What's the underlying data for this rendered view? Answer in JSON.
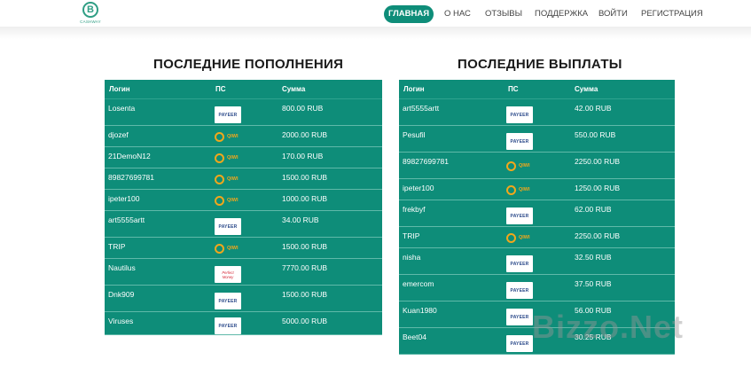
{
  "header": {
    "logo_text": "CASHWAY",
    "logo_mark": "B",
    "nav": [
      {
        "label": "ГЛАВНАЯ",
        "active": true
      },
      {
        "label": "О НАС",
        "active": false
      },
      {
        "label": "ОТЗЫВЫ",
        "active": false
      },
      {
        "label": "ПОДДЕРЖКА",
        "active": false
      },
      {
        "label": "ВОЙТИ",
        "active": false
      },
      {
        "label": "РЕГИСТРАЦИЯ",
        "active": false
      }
    ]
  },
  "deposits": {
    "title": "ПОСЛЕДНИЕ ПОПОЛНЕНИЯ",
    "columns": [
      "Логин",
      "ПС",
      "Сумма"
    ],
    "rows": [
      {
        "login": "Losenta",
        "ps": "payeer",
        "amount": "800.00 RUB"
      },
      {
        "login": "djozef",
        "ps": "qiwi",
        "amount": "2000.00 RUB"
      },
      {
        "login": "21DemoN12",
        "ps": "qiwi",
        "amount": "170.00 RUB"
      },
      {
        "login": "89827699781",
        "ps": "qiwi",
        "amount": "1500.00 RUB"
      },
      {
        "login": "ipeter100",
        "ps": "qiwi",
        "amount": "1000.00 RUB"
      },
      {
        "login": "art5555artt",
        "ps": "payeer",
        "amount": "34.00 RUB"
      },
      {
        "login": "TRIP",
        "ps": "qiwi",
        "amount": "1500.00 RUB"
      },
      {
        "login": "Nautilus",
        "ps": "perfect",
        "amount": "7770.00 RUB"
      },
      {
        "login": "Dnk909",
        "ps": "payeer",
        "amount": "1500.00 RUB"
      },
      {
        "login": "Viruses",
        "ps": "payeer",
        "amount": "5000.00 RUB"
      }
    ]
  },
  "payouts": {
    "title": "ПОСЛЕДНИЕ ВЫПЛАТЫ",
    "columns": [
      "Логин",
      "ПС",
      "Сумма"
    ],
    "rows": [
      {
        "login": "art5555artt",
        "ps": "payeer",
        "amount": "42.00 RUB"
      },
      {
        "login": "Pesufil",
        "ps": "payeer",
        "amount": "550.00 RUB"
      },
      {
        "login": "89827699781",
        "ps": "qiwi",
        "amount": "2250.00 RUB"
      },
      {
        "login": "ipeter100",
        "ps": "qiwi",
        "amount": "1250.00 RUB"
      },
      {
        "login": "frekbyf",
        "ps": "payeer",
        "amount": "62.00 RUB"
      },
      {
        "login": "TRIP",
        "ps": "qiwi",
        "amount": "2250.00 RUB"
      },
      {
        "login": "nisha",
        "ps": "payeer",
        "amount": "32.50 RUB"
      },
      {
        "login": "emercom",
        "ps": "payeer",
        "amount": "37.50 RUB"
      },
      {
        "login": "Kuan1980",
        "ps": "payeer",
        "amount": "56.00 RUB"
      },
      {
        "login": "Beet04",
        "ps": "payeer",
        "amount": "30.25 RUB"
      }
    ]
  },
  "ps_labels": {
    "payeer": "PAYEER",
    "qiwi": "QIWI",
    "perfect_line1": "Perfect",
    "perfect_line2": "Money"
  },
  "watermark": "Bizzo.Net",
  "colors": {
    "accent": "#0e8d79",
    "qiwi": "#f2a71b",
    "payeer_text": "#2b4a8a"
  }
}
